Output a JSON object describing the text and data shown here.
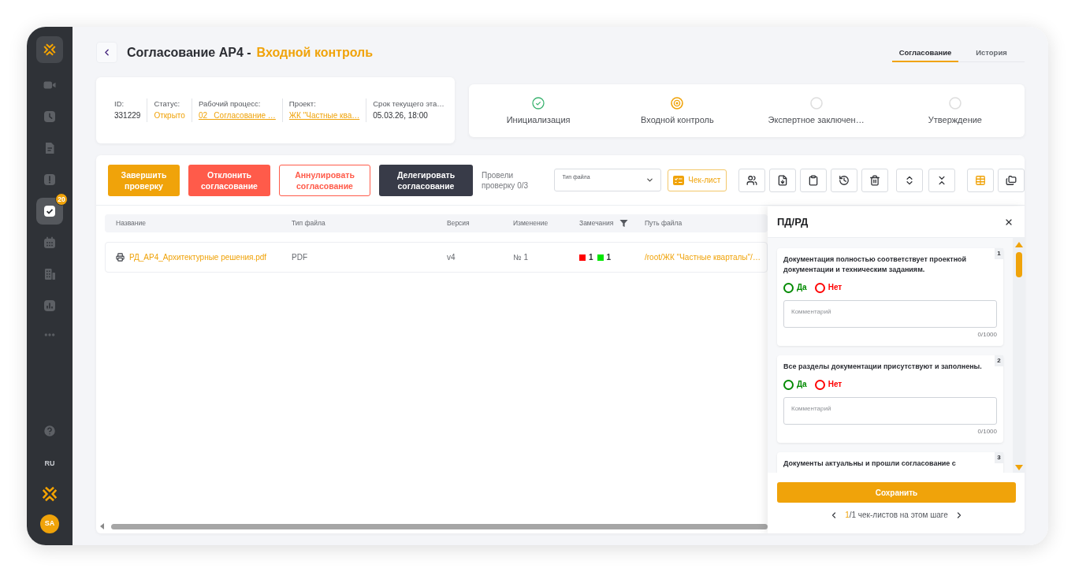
{
  "sidebar": {
    "nav_items": [
      {
        "selected": false
      },
      {
        "selected": false
      },
      {
        "selected": false
      },
      {
        "selected": false
      },
      {
        "selected": true,
        "badge": "20"
      },
      {
        "selected": false
      },
      {
        "selected": false
      },
      {
        "selected": false
      }
    ],
    "language": "RU",
    "user_initials": "SA"
  },
  "header": {
    "title": "Согласование АР4 -",
    "stage": "Входной контроль"
  },
  "tabs": [
    {
      "label": "Согласование",
      "selected": true
    },
    {
      "label": "История",
      "selected": false
    }
  ],
  "info_fields": [
    {
      "kind": "text",
      "label": "ID:",
      "value": "331229"
    },
    {
      "kind": "status",
      "label": "Статус:",
      "value": "Открыто"
    },
    {
      "kind": "link",
      "label": "Рабочий процесс:",
      "value": "02_ Согласование …"
    },
    {
      "kind": "link",
      "label": "Проект:",
      "value": "ЖК \"Частные ква…"
    },
    {
      "kind": "text",
      "label": "Срок текущего эта…",
      "value": "05.03.26, 18:00"
    }
  ],
  "stages": [
    {
      "label": "Инициализация",
      "completed": true,
      "selected": false
    },
    {
      "label": "Входной контроль",
      "completed": false,
      "selected": true
    },
    {
      "label": "Экспертное заключен…",
      "completed": false,
      "selected": false
    },
    {
      "label": "Утверждение",
      "completed": false,
      "selected": false
    }
  ],
  "toolbar": {
    "actions": [
      {
        "kind": "primary",
        "label": "Завершить проверку"
      },
      {
        "kind": "danger",
        "label": "Отклонить согласование"
      },
      {
        "kind": "outline",
        "label": "Аннулировать согласование"
      },
      {
        "kind": "dark",
        "label": "Делегировать согласование"
      }
    ],
    "progress": "Провели проверку 0/3",
    "file_type_select": {
      "placeholder": "Тип файла"
    },
    "checklist_button": "Чек-лист",
    "view_modes": [
      {
        "selected": true
      },
      {
        "selected": false
      }
    ]
  },
  "table": {
    "columns": [
      {
        "label": "Название",
        "filterable": false
      },
      {
        "label": "Тип файла",
        "filterable": false
      },
      {
        "label": "Версия",
        "filterable": false
      },
      {
        "label": "Изменение",
        "filterable": false
      },
      {
        "label": "Замечания",
        "filterable": true
      },
      {
        "label": "Путь файла",
        "filterable": false
      }
    ],
    "rows": [
      {
        "name": "РД_АР4_Архитектурные решения.pdf",
        "file_type": "PDF",
        "version": "v4",
        "change": "№ 1",
        "remarks": [
          {
            "count": "1",
            "color": "#ff0000"
          },
          {
            "count": "1",
            "color": "#00e600"
          }
        ],
        "path": "/root/ЖК \"Частные кварталы\"/…"
      }
    ]
  },
  "checklist_panel": {
    "title": "ПД/РД",
    "items": [
      {
        "number": "1",
        "question": "Документация полностью соответствует проектной документации и техническим заданиям.",
        "options": [
          {
            "label": "Да",
            "selected": false,
            "color": "#008a00"
          },
          {
            "label": "Нет",
            "selected": false,
            "color": "#ff0000"
          }
        ],
        "comment": {
          "placeholder": "Комментарий",
          "counter": "0/1000"
        }
      },
      {
        "number": "2",
        "question": "Все разделы документации присутствуют и заполнены.",
        "options": [
          {
            "label": "Да",
            "selected": false,
            "color": "#008a00"
          },
          {
            "label": "Нет",
            "selected": false,
            "color": "#ff0000"
          }
        ],
        "comment": {
          "placeholder": "Комментарий",
          "counter": "0/1000"
        }
      },
      {
        "number": "3",
        "question": "Документы актуальны и прошли согласование с"
      }
    ],
    "save_button": "Сохранить",
    "pager": {
      "current": "1",
      "text": "/1 чек-листов на этом шаге"
    }
  }
}
